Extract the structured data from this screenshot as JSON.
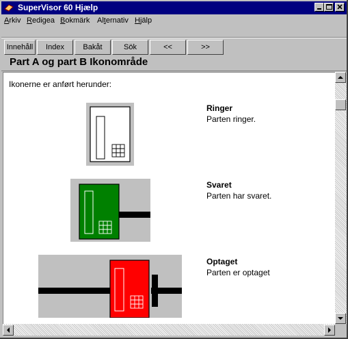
{
  "window": {
    "title": "SuperVisor 60 Hjælp",
    "buttons": [
      "minimize-icon",
      "maximize-icon",
      "close-icon"
    ]
  },
  "menu": [
    {
      "accel": "A",
      "rest": "rkiv"
    },
    {
      "accel": "R",
      "rest": "edigea"
    },
    {
      "accel": "B",
      "rest": "okmärk"
    },
    {
      "pre": "Al",
      "accel": "t",
      "rest": "ernativ"
    },
    {
      "accel": "H",
      "rest": "jälp"
    }
  ],
  "toolbar": {
    "contents": "Innehåll",
    "index": "Index",
    "back": "Bakåt",
    "search": "Sök",
    "prev": "<<",
    "next": ">>"
  },
  "page": {
    "title": "Part A og part B Ikonområde",
    "intro": "Ikonerne er anført herunder:"
  },
  "entries": [
    {
      "title": "Ringer",
      "desc": "Parten ringer.",
      "icon": "phone-ringing-icon",
      "color": "#ffffff"
    },
    {
      "title": "Svaret",
      "desc": "Parten har svaret.",
      "icon": "phone-answered-icon",
      "color": "#008000"
    },
    {
      "title": "Optaget",
      "desc": "Parten er optaget",
      "icon": "phone-busy-icon",
      "color": "#ff0000"
    }
  ],
  "colors": {
    "titlebar": "#000080",
    "window_chrome": "#c0c0c0",
    "answered": "#008000",
    "busy": "#ff0000"
  }
}
